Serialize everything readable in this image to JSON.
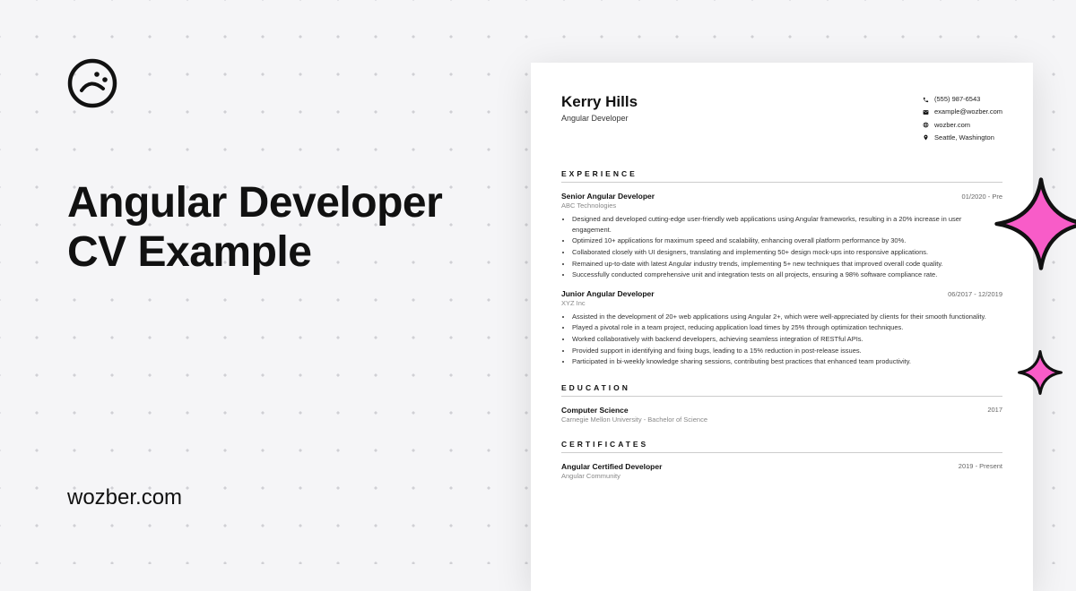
{
  "title_line1": "Angular Developer",
  "title_line2": "CV Example",
  "site": "wozber.com",
  "resume": {
    "name": "Kerry Hills",
    "role": "Angular Developer",
    "contacts": {
      "phone": "(555) 987-6543",
      "email": "example@wozber.com",
      "web": "wozber.com",
      "location": "Seattle, Washington"
    },
    "sections": {
      "experience": "EXPERIENCE",
      "education": "EDUCATION",
      "certificates": "CERTIFICATES"
    },
    "jobs": [
      {
        "title": "Senior Angular Developer",
        "dates": "01/2020 - Pre",
        "company": "ABC Technologies",
        "bullets": [
          "Designed and developed cutting-edge user-friendly web applications using Angular frameworks, resulting in a 20% increase in user engagement.",
          "Optimized 10+ applications for maximum speed and scalability, enhancing overall platform performance by 30%.",
          "Collaborated closely with UI designers, translating and implementing 50+ design mock-ups into responsive applications.",
          "Remained up-to-date with latest Angular industry trends, implementing 5+ new techniques that improved overall code quality.",
          "Successfully conducted comprehensive unit and integration tests on all projects, ensuring a 98% software compliance rate."
        ]
      },
      {
        "title": "Junior Angular Developer",
        "dates": "06/2017 - 12/2019",
        "company": "XYZ Inc",
        "bullets": [
          "Assisted in the development of 20+ web applications using Angular 2+, which were well-appreciated by clients for their smooth functionality.",
          "Played a pivotal role in a team project, reducing application load times by 25% through optimization techniques.",
          "Worked collaboratively with backend developers, achieving seamless integration of RESTful APIs.",
          "Provided support in identifying and fixing bugs, leading to a 15% reduction in post-release issues.",
          "Participated in bi-weekly knowledge sharing sessions, contributing best practices that enhanced team productivity."
        ]
      }
    ],
    "education": {
      "degree": "Computer Science",
      "school": "Carnegie Mellon University - Bachelor of Science",
      "year": "2017"
    },
    "certificate": {
      "name": "Angular Certified Developer",
      "org": "Angular Community",
      "dates": "2019 - Present"
    }
  }
}
